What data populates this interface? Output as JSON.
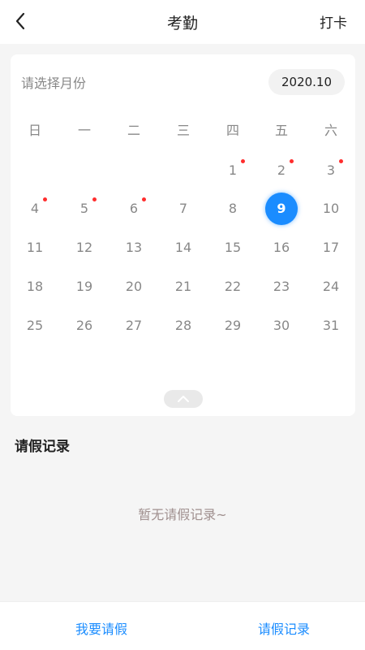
{
  "header": {
    "title": "考勤",
    "action_label": "打卡"
  },
  "calendar": {
    "prompt": "请选择月份",
    "month_value": "2020.10",
    "weekdays": [
      "日",
      "一",
      "二",
      "三",
      "四",
      "五",
      "六"
    ],
    "first_weekday_index": 4,
    "days_in_month": 31,
    "selected_day": 9,
    "marked_days": [
      1,
      2,
      3,
      4,
      5,
      6
    ],
    "colors": {
      "selected": "#1a8cff",
      "marker_dot": "#ff2d2d"
    }
  },
  "records": {
    "title": "请假记录",
    "empty_text": "暂无请假记录~"
  },
  "footer": {
    "left_label": "我要请假",
    "right_label": "请假记录",
    "accent_color": "#1a8cff"
  },
  "icons": {
    "back": "chevron-left-icon",
    "collapse": "chevron-up-icon"
  }
}
